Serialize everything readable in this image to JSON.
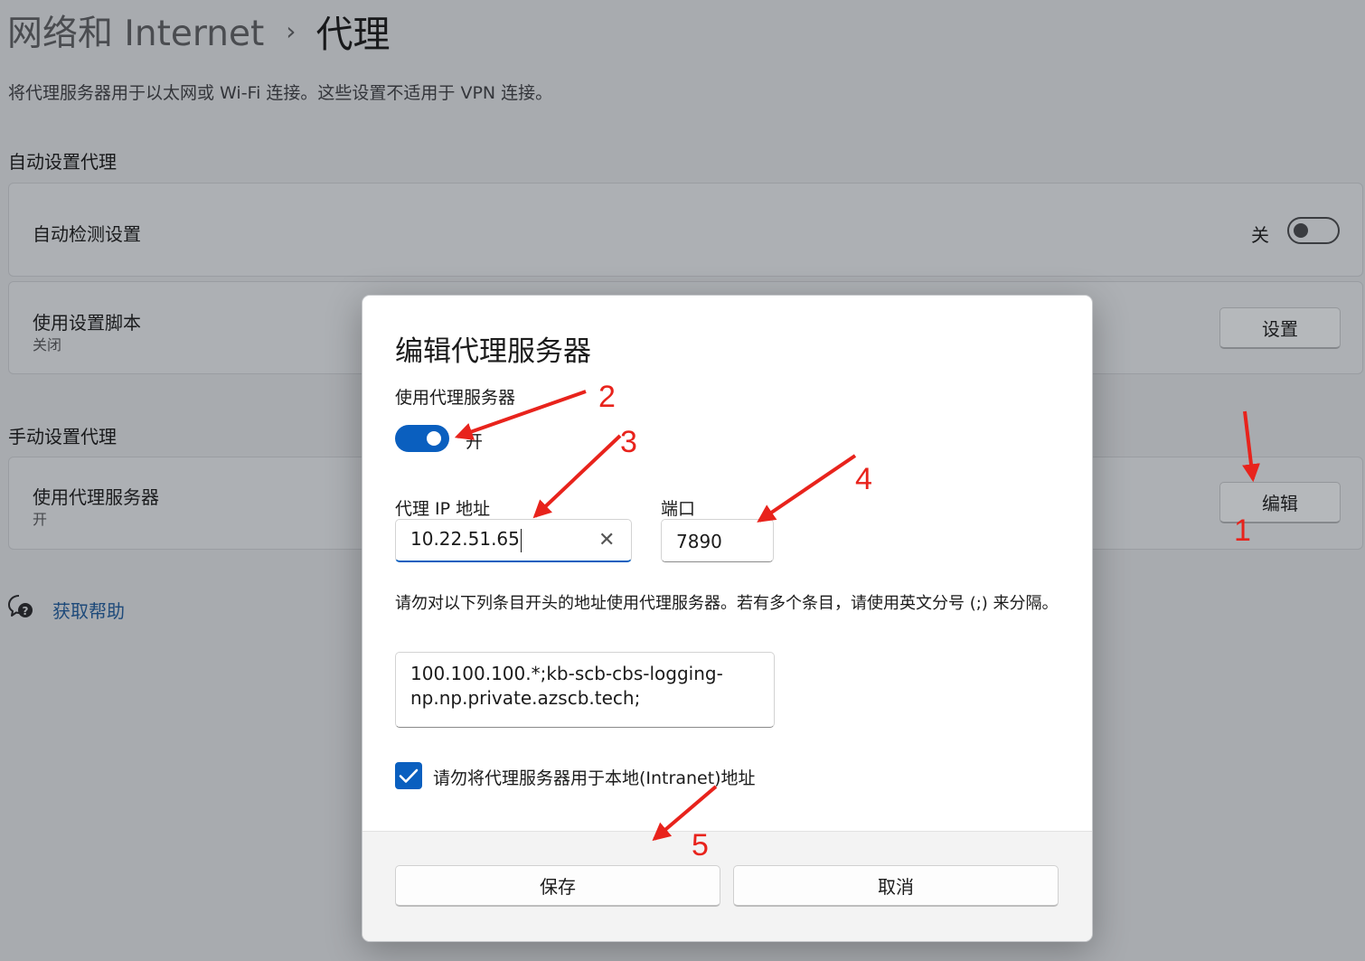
{
  "page": {
    "breadcrumb_parent": "网络和 Internet",
    "breadcrumb_separator": "›",
    "breadcrumb_current": "代理",
    "description": "将代理服务器用于以太网或 Wi-Fi 连接。这些设置不适用于 VPN 连接。"
  },
  "auto_section": {
    "title": "自动设置代理",
    "detect": {
      "label": "自动检测设置",
      "state_label": "关",
      "on": false
    },
    "script": {
      "label": "使用设置脚本",
      "status": "关闭",
      "button": "设置"
    }
  },
  "manual_section": {
    "title": "手动设置代理",
    "proxy": {
      "label": "使用代理服务器",
      "status": "开",
      "button": "编辑"
    }
  },
  "help": {
    "label": "获取帮助"
  },
  "dialog": {
    "title": "编辑代理服务器",
    "use_proxy_label": "使用代理服务器",
    "use_proxy_state": "开",
    "use_proxy_on": true,
    "ip_label": "代理 IP 地址",
    "ip_value": "10.22.51.65",
    "port_label": "端口",
    "port_value": "7890",
    "exceptions_description": "请勿对以下列条目开头的地址使用代理服务器。若有多个条目，请使用英文分号 (;) 来分隔。",
    "exceptions_line1": "100.100.100.*;kb-scb-cbs-logging-",
    "exceptions_line2": "np.np.private.azscb.tech;",
    "bypass_local_label": "请勿将代理服务器用于本地(Intranet)地址",
    "bypass_local_checked": true,
    "save_button": "保存",
    "cancel_button": "取消"
  },
  "annotations": [
    "1",
    "2",
    "3",
    "4",
    "5"
  ],
  "colors": {
    "accent": "#0a5fbf",
    "annotation_red": "#e8231c",
    "overlay_background": "#a8abaf",
    "link": "#1e4a7a"
  }
}
